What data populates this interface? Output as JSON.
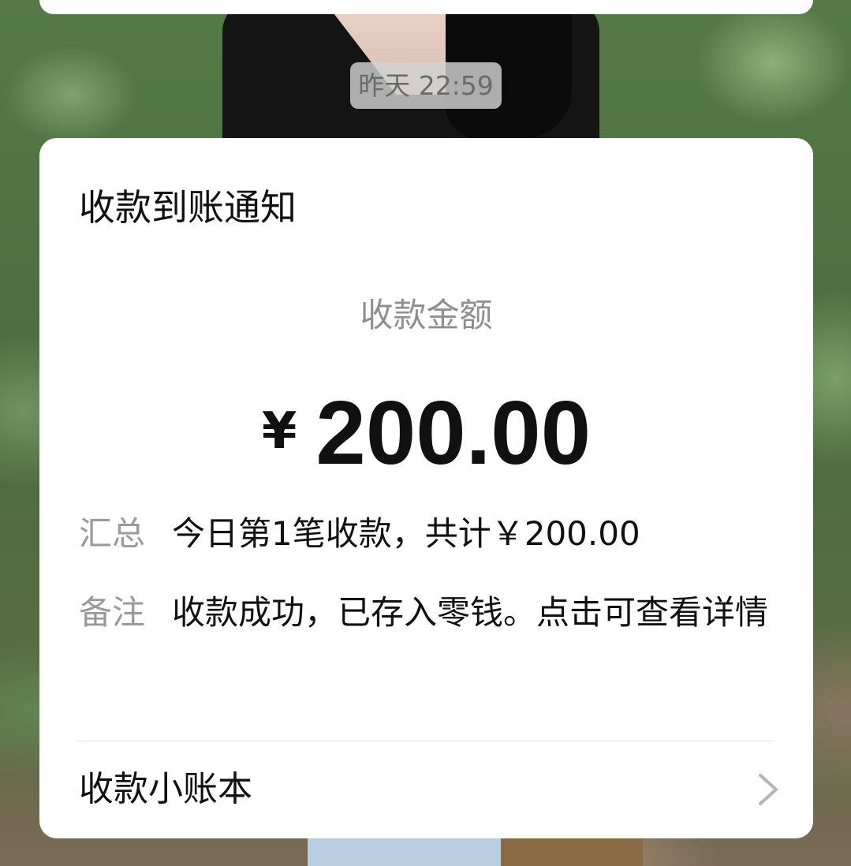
{
  "timestamp": "昨天 22:59",
  "card": {
    "title": "收款到账通知",
    "amount_label": "收款金额",
    "currency_symbol": "¥",
    "amount": "200.00",
    "summary": {
      "label": "汇总",
      "value": "今日第1笔收款，共计￥200.00"
    },
    "remark": {
      "label": "备注",
      "value": "收款成功，已存入零钱。点击可查看详情"
    },
    "footer_label": "收款小账本"
  },
  "icons": {
    "footer": "chevron-right-icon"
  },
  "colors": {
    "card_background": "#ffffff",
    "primary_text": "#111111",
    "secondary_text": "#9a9a9a",
    "timestamp_background": "#d2d2d2"
  }
}
